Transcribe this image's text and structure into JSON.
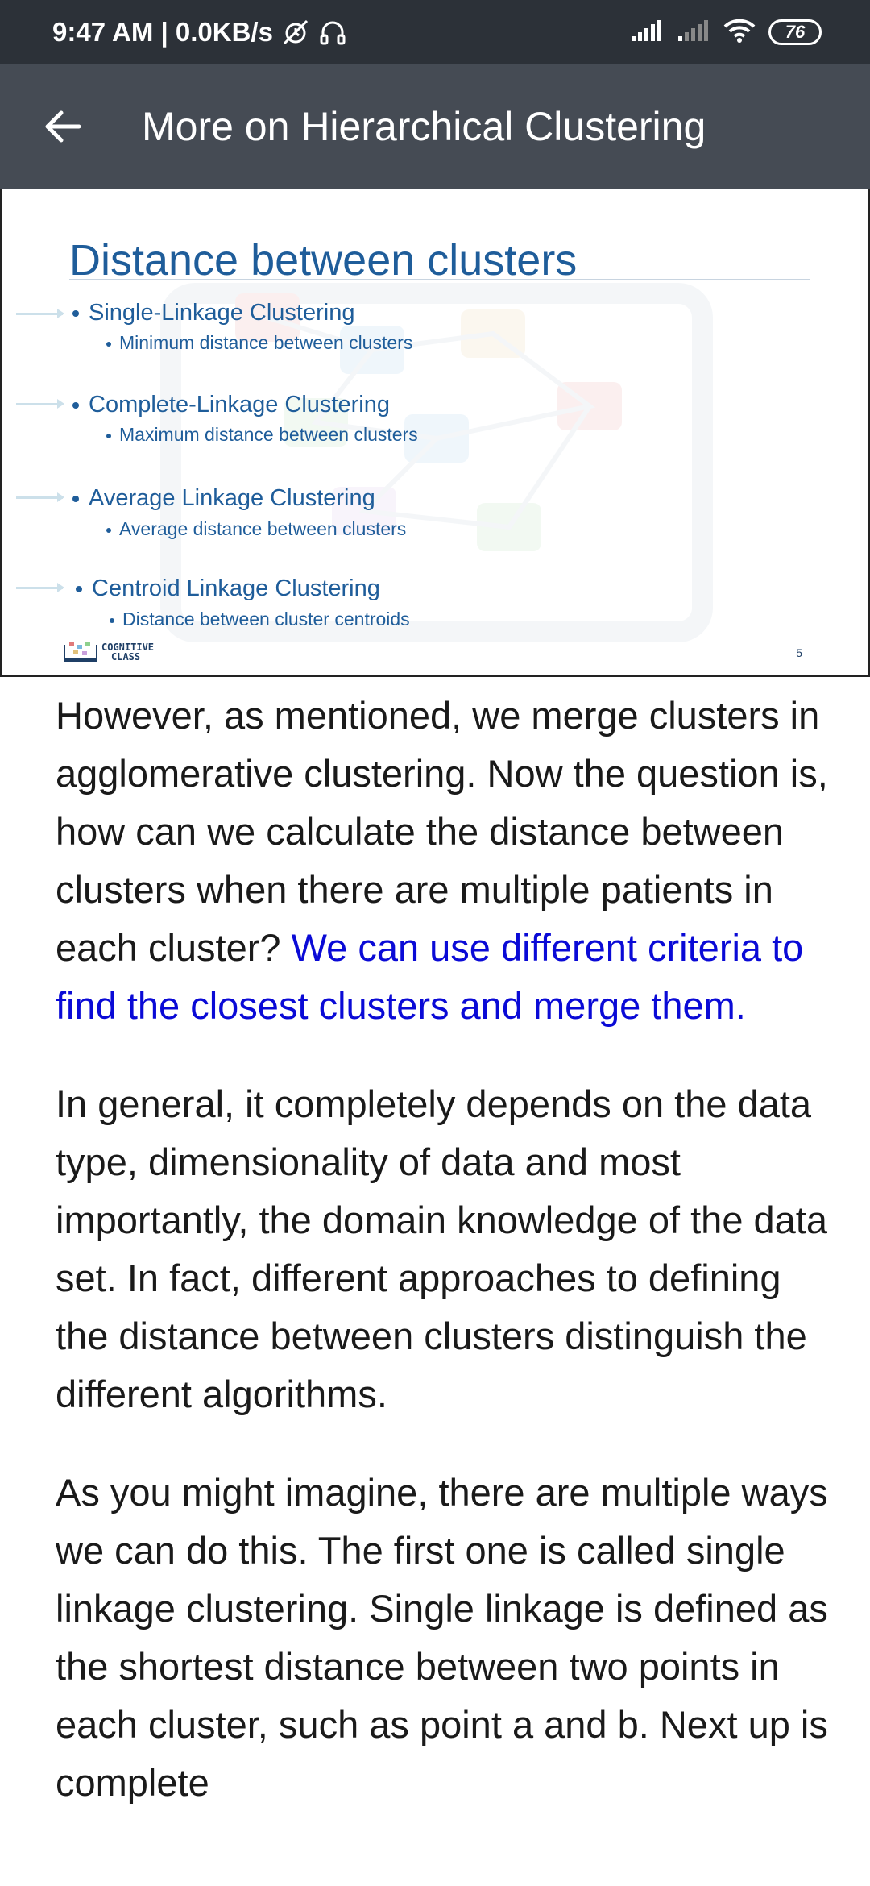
{
  "status_bar": {
    "time_speed": "9:47 AM | 0.0KB/s",
    "battery": "76"
  },
  "app_bar": {
    "title": "More on Hierarchical Clustering"
  },
  "slide": {
    "title": "Distance between clusters",
    "items": [
      {
        "label": "Single-Linkage Clustering",
        "sub": "Minimum distance between clusters"
      },
      {
        "label": "Complete-Linkage Clustering",
        "sub": "Maximum distance between clusters"
      },
      {
        "label": "Average Linkage Clustering",
        "sub": "Average distance between clusters"
      },
      {
        "label": "Centroid Linkage Clustering",
        "sub": "Distance between cluster centroids"
      }
    ],
    "logo_line1": "COGNITIVE",
    "logo_line2": "CLASS",
    "page_number": "5"
  },
  "article": {
    "p1_text": "However, as mentioned, we merge clusters in agglomerative clustering. Now the question is, how can we calculate the distance between clusters when there are multiple patients in each cluster?",
    "p1_highlight": "We can use different criteria to find the closest clusters and merge them.",
    "p2": "In general, it completely depends on the data type, dimensionality of data and most importantly, the domain knowledge of the data set. In fact, different approaches to defining the distance between clusters distinguish the different algorithms.",
    "p3": "As you might imagine, there are multiple ways we can do this. The first one is called single linkage clustering. Single linkage is defined as the shortest distance between two points in each cluster, such as point a and b. Next up is complete"
  },
  "colors": {
    "status_bar_bg": "#2c3138",
    "app_bar_bg": "#454b54",
    "slide_text": "#1f5d9a",
    "highlight_text": "#0a0ad6"
  }
}
